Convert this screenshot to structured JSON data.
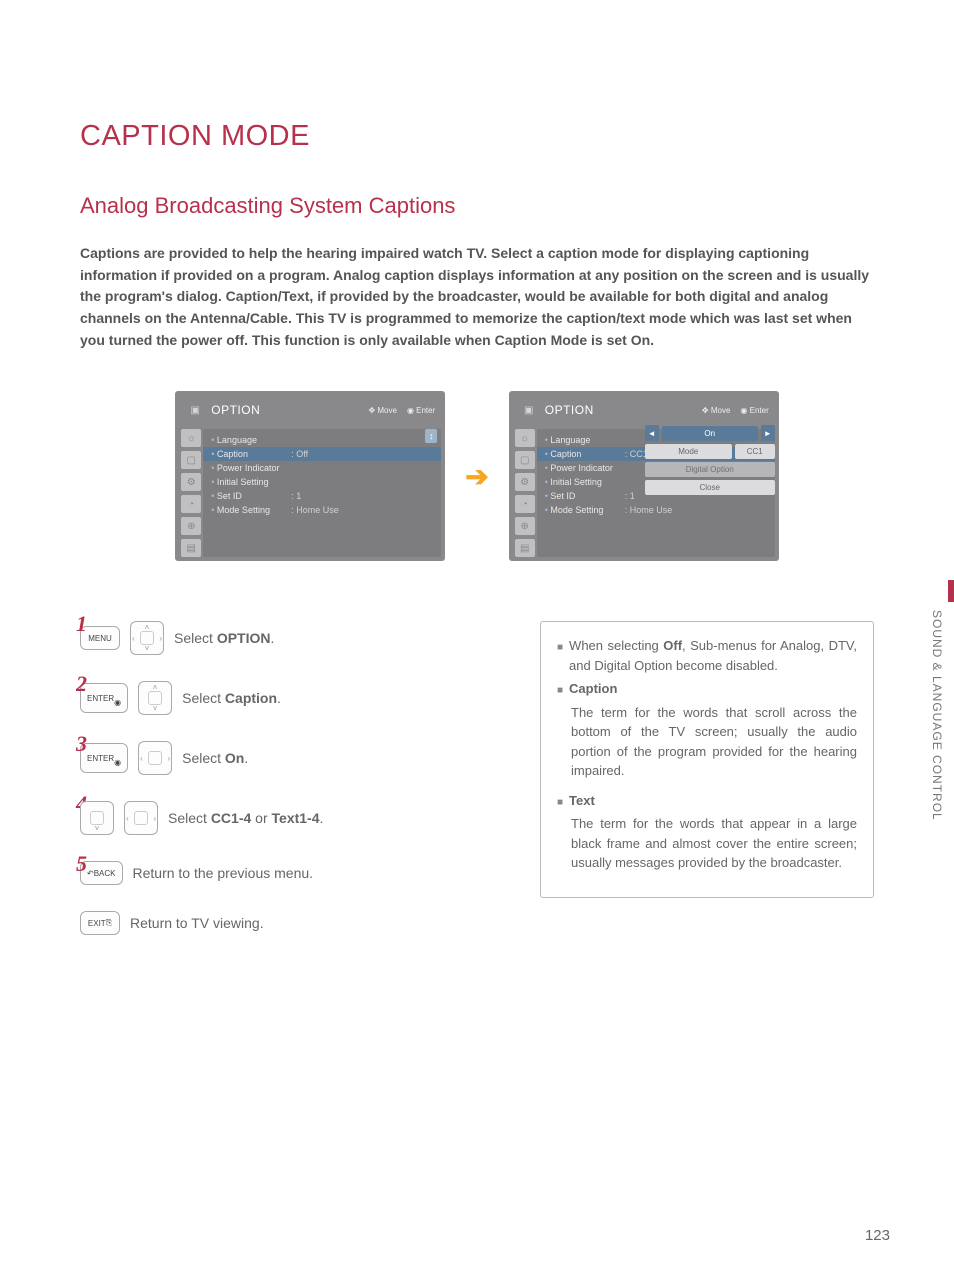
{
  "page": {
    "title": "CAPTION MODE",
    "subtitle": "Analog Broadcasting System Captions",
    "intro": "Captions are provided to help the hearing impaired watch TV. Select a caption mode for displaying captioning information if provided on a program. Analog caption displays information at any position on the screen and is usually the program's dialog. Caption/Text, if provided by the broadcaster, would be available for both digital and analog channels on the Antenna/Cable. This TV is programmed to memorize the caption/text mode which was last set when you turned the power off. This function is only available when Caption Mode is set On.",
    "side_tab": "SOUND & LANGUAGE CONTROL",
    "page_number": "123"
  },
  "osd": {
    "title": "OPTION",
    "move": "Move",
    "enter": "Enter",
    "items": {
      "language": "Language",
      "caption": "Caption",
      "power_indicator": "Power Indicator",
      "initial_setting": "Initial Setting",
      "set_id": "Set ID",
      "mode_setting": "Mode Setting"
    },
    "values": {
      "caption_off": ": Off",
      "caption_cc1": ": CC1",
      "set_id": ": 1",
      "mode_setting": ": Home Use"
    },
    "popup": {
      "on": "On",
      "mode": "Mode",
      "mode_val": "CC1",
      "digital_option": "Digital Option",
      "close": "Close"
    }
  },
  "steps": {
    "s1": {
      "key": "MENU",
      "text_pre": "Select ",
      "text_bold": "OPTION",
      "text_post": "."
    },
    "s2": {
      "key": "ENTER",
      "text_pre": "Select ",
      "text_bold": "Caption",
      "text_post": "."
    },
    "s3": {
      "key": "ENTER",
      "text_pre": "Select ",
      "text_bold": "On",
      "text_post": "."
    },
    "s4": {
      "text_pre": "Select ",
      "text_bold1": "CC1-4",
      "text_mid": " or ",
      "text_bold2": "Text1-4",
      "text_post": "."
    },
    "s5": {
      "key": "BACK",
      "text": "Return to the previous menu."
    },
    "s6": {
      "key": "EXIT",
      "text": "Return to TV viewing."
    }
  },
  "info": {
    "off_pre": "When selecting ",
    "off_bold": "Off",
    "off_post": ", Sub-menus for Analog, DTV, and Digital Option become disabled.",
    "caption_head": "Caption",
    "caption_body": "The term for the words that scroll across the bottom of the TV screen; usually the audio portion of the program provided for the hearing impaired.",
    "text_head": "Text",
    "text_body": "The term for the words that appear in a large black frame and almost cover the entire screen; usually messages provided by the broadcaster."
  }
}
